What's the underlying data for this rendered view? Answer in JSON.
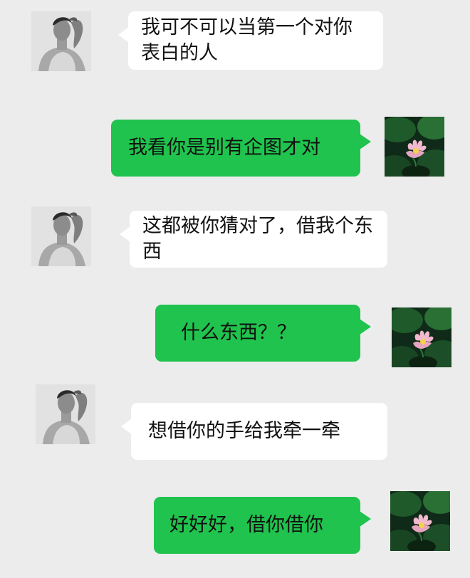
{
  "chat": {
    "messages": [
      {
        "side": "incoming",
        "text": "我可不可以当第一个对你表白的人",
        "avatar": "man-portrait-avatar"
      },
      {
        "side": "outgoing",
        "text": "我看你是别有企图才对",
        "avatar": "lotus-avatar"
      },
      {
        "side": "incoming",
        "text": "这都被你猜对了，借我个东西",
        "avatar": "man-portrait-avatar"
      },
      {
        "side": "outgoing",
        "text": "什么东西？？",
        "avatar": "lotus-avatar"
      },
      {
        "side": "incoming",
        "text": "想借你的手给我牵一牵",
        "avatar": "man-portrait-avatar"
      },
      {
        "side": "outgoing",
        "text": "好好好，借你借你",
        "avatar": "lotus-avatar"
      }
    ]
  },
  "colors": {
    "background": "#ececec",
    "incoming_bubble": "#ffffff",
    "outgoing_bubble": "#20c34d",
    "text": "#111111"
  }
}
